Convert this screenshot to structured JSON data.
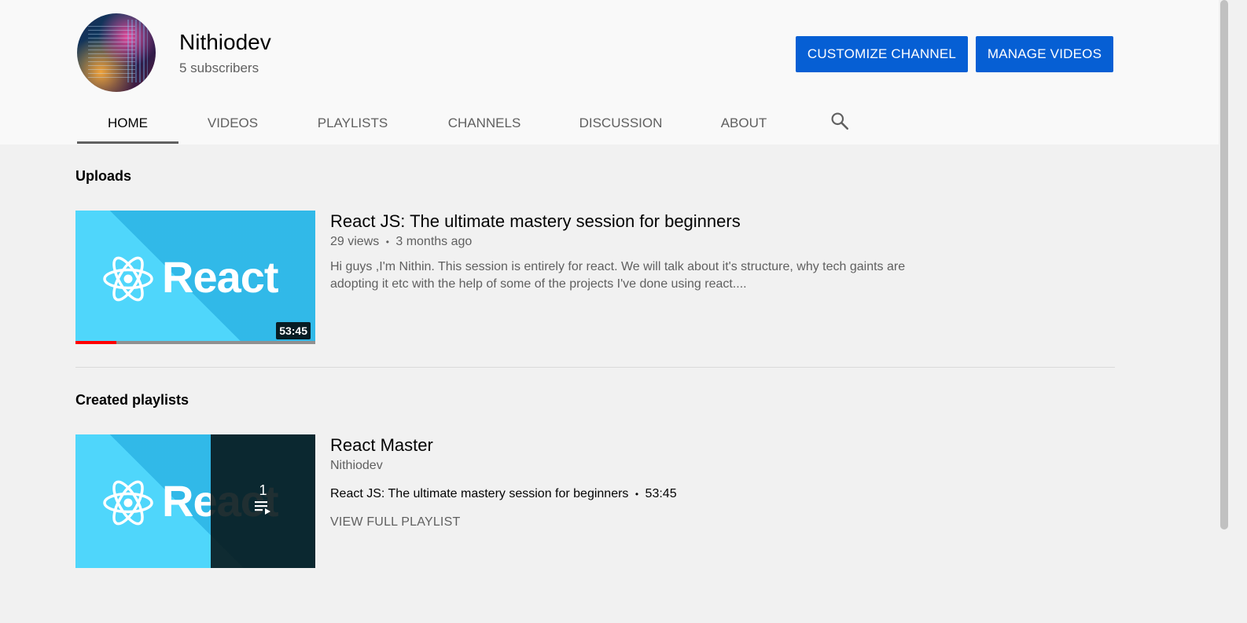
{
  "channel": {
    "name": "Nithiodev",
    "subscribers": "5 subscribers",
    "avatar_icon": "code-screen-avatar"
  },
  "buttons": {
    "customize": "CUSTOMIZE CHANNEL",
    "manage": "MANAGE VIDEOS"
  },
  "tabs": [
    {
      "label": "HOME",
      "active": true
    },
    {
      "label": "VIDEOS",
      "active": false
    },
    {
      "label": "PLAYLISTS",
      "active": false
    },
    {
      "label": "CHANNELS",
      "active": false
    },
    {
      "label": "DISCUSSION",
      "active": false
    },
    {
      "label": "ABOUT",
      "active": false
    }
  ],
  "search_icon": "search-icon",
  "uploads": {
    "section_title": "Uploads",
    "video": {
      "thumbnail_text": "React",
      "duration": "53:45",
      "watched_fraction": 0.17,
      "title": "React JS: The ultimate mastery session for beginners",
      "views": "29 views",
      "separator": "•",
      "age": "3 months ago",
      "description_line1": "Hi guys ,I'm Nithin. This session is entirely for react. We will talk about it's structure, why tech gaints are",
      "description_line2": "adopting it etc with the help of some of the projects I've done using react...."
    }
  },
  "playlists": {
    "section_title": "Created playlists",
    "playlist": {
      "thumbnail_text": "React",
      "video_count": "1",
      "queue_icon": "playlist-queue-icon",
      "title": "React Master",
      "owner": "Nithiodev",
      "first_video": "React JS: The ultimate mastery session for beginners",
      "separator": "•",
      "first_video_duration": "53:45",
      "view_full": "VIEW FULL PLAYLIST"
    }
  },
  "colors": {
    "primary_button": "#065fd4",
    "thumbnail_bg": "#4fd6fb",
    "progress": "#ff0000"
  }
}
